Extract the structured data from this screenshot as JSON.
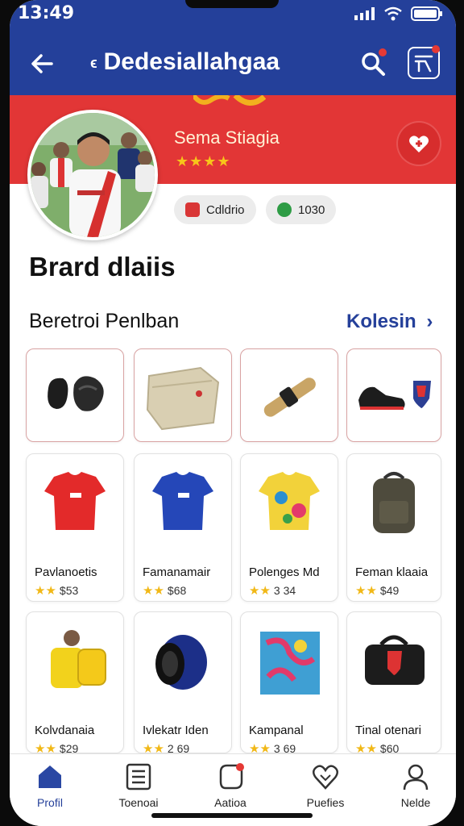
{
  "status": {
    "time": "13:49"
  },
  "appbar": {
    "title": "Dedesiallahgaa",
    "back_icon": "arrow-left-icon",
    "search_icon": "search-icon",
    "cart_icon": "receipt-icon"
  },
  "profile": {
    "name": "Sema Stiagia",
    "rating_stars": "★★★★",
    "rating_value": 4,
    "chips": [
      {
        "label": "Cdldrio",
        "icon": "calendar-icon",
        "color": "#d93636"
      },
      {
        "label": "1030",
        "icon": "leaf-icon",
        "color": "#2e9c45"
      }
    ],
    "favorite_icon": "plus-heart-icon"
  },
  "section": {
    "title": "Brard dlaiis",
    "subtitle": "Beretroi Penlban",
    "link_label": "Kolesin"
  },
  "accessories": [
    {
      "icon": "shin-guards-icon"
    },
    {
      "icon": "bag-icon"
    },
    {
      "icon": "grip-tape-icon"
    },
    {
      "icon": "shoe-badge-icon"
    }
  ],
  "products": [
    {
      "name": "Pavlanoetis",
      "stars": "★★",
      "price": "$53",
      "icon": "red-jersey-icon"
    },
    {
      "name": "Famanamair",
      "stars": "★★",
      "price": "$68",
      "icon": "blue-jersey-icon"
    },
    {
      "name": "Polenges Md",
      "stars": "★★",
      "price": "3 34",
      "icon": "floral-jersey-icon"
    },
    {
      "name": "Feman klaaia",
      "stars": "★★",
      "price": "$49",
      "icon": "backpack-icon"
    },
    {
      "name": "Kolvdanaia",
      "stars": "★★",
      "price": "$29",
      "icon": "yellow-backpack-icon"
    },
    {
      "name": "Ivlekatr Iden",
      "stars": "★★",
      "price": "2 69",
      "icon": "headband-icon"
    },
    {
      "name": "Kampanal",
      "stars": "★★",
      "price": "3 69",
      "icon": "towel-icon"
    },
    {
      "name": "Tinal otenari",
      "stars": "★★",
      "price": "$60",
      "icon": "duffel-bag-icon"
    }
  ],
  "bottom_nav": [
    {
      "label": "Profil",
      "icon": "home-icon",
      "active": true
    },
    {
      "label": "Toenoai",
      "icon": "list-icon",
      "active": false
    },
    {
      "label": "Aatioa",
      "icon": "notification-icon",
      "active": false
    },
    {
      "label": "Puefies",
      "icon": "heart-icon",
      "active": false
    },
    {
      "label": "Nelde",
      "icon": "user-icon",
      "active": false
    }
  ],
  "colors": {
    "header": "#24409a",
    "hero": "#e23636",
    "accent": "#25409a",
    "star": "#f1b817"
  }
}
